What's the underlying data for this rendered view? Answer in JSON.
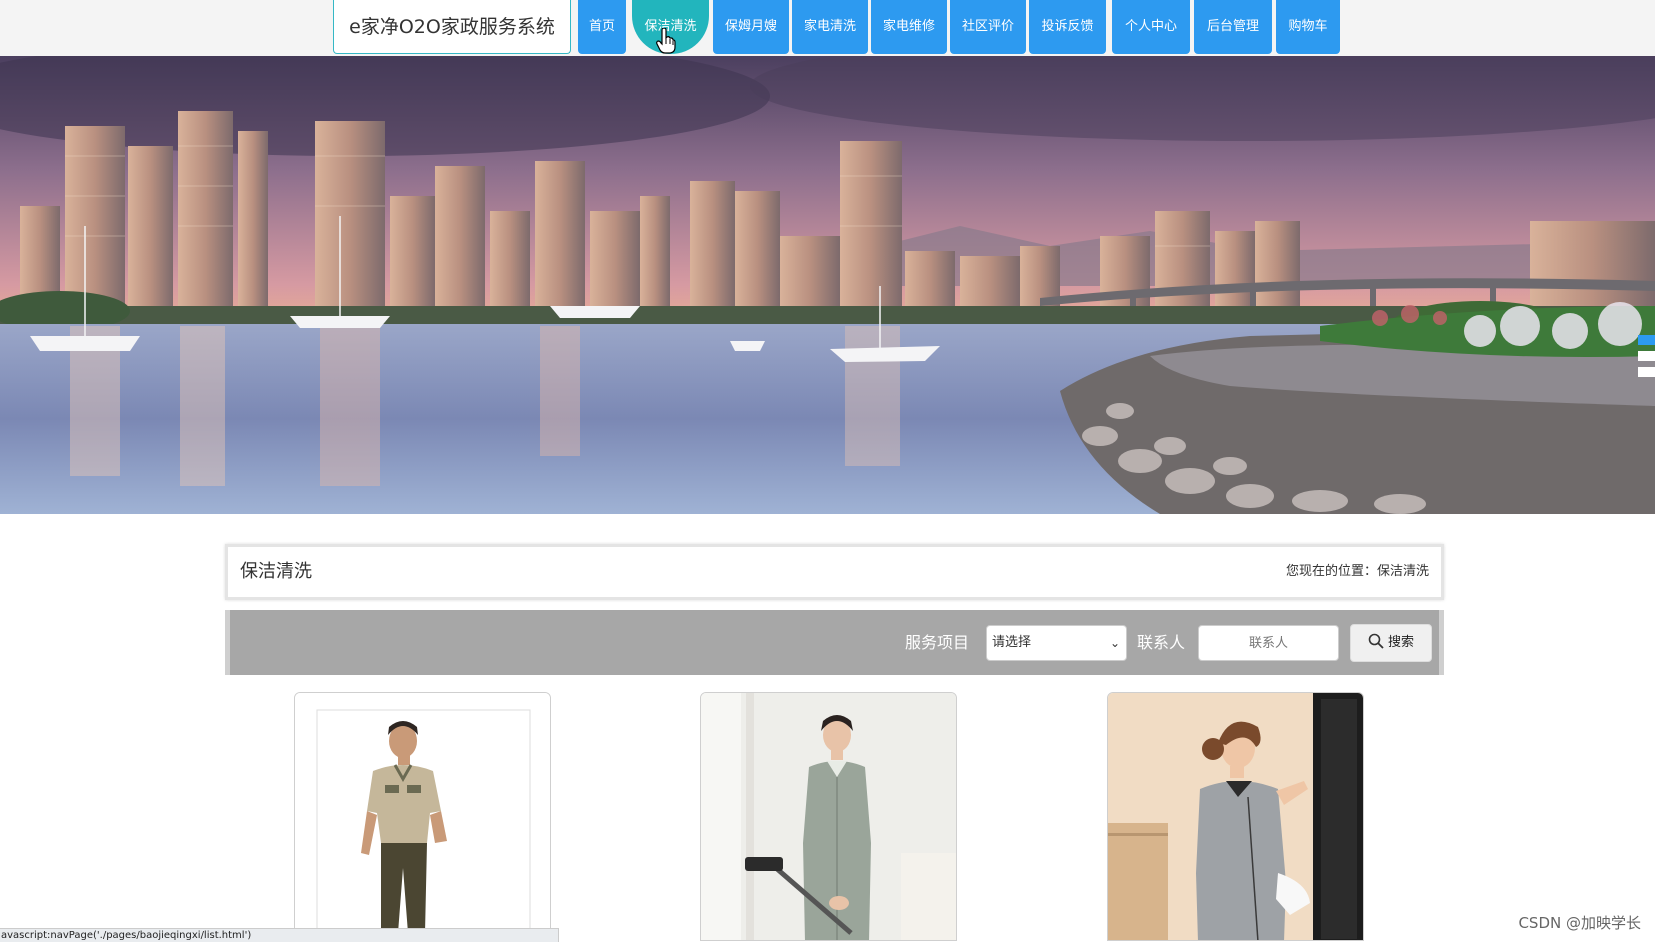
{
  "nav": {
    "brand": "e家净O2O家政服务系统",
    "items": [
      {
        "label": "首页"
      },
      {
        "label": "保洁清洗",
        "active": true
      },
      {
        "label": "保姆月嫂"
      },
      {
        "label": "家电清洗"
      },
      {
        "label": "家电维修"
      },
      {
        "label": "社区评价"
      },
      {
        "label": "投诉反馈"
      },
      {
        "label": "个人中心"
      },
      {
        "label": "后台管理"
      },
      {
        "label": "购物车"
      }
    ]
  },
  "banner": {
    "slides": 3,
    "active_slide": 1
  },
  "page": {
    "title": "保洁清洗",
    "breadcrumb": "您现在的位置：保洁清洗"
  },
  "search": {
    "service_label": "服务项目",
    "service_value": "请选择",
    "contact_label": "联系人",
    "contact_placeholder": "联系人",
    "button_label": "搜索"
  },
  "status_url": "avascript:navPage('./pages/baojieqingxi/list.html')",
  "watermark": "CSDN @加映学长",
  "colors": {
    "nav_blue": "#2d9af0",
    "nav_active": "#22b5bd",
    "searchbar_gray": "#a7a7a7"
  }
}
